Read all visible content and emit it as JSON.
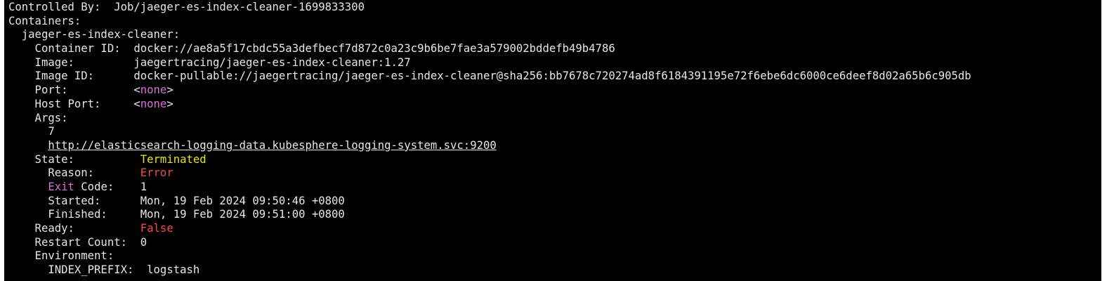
{
  "terminal": {
    "lines": [
      {
        "id": "controlled-by",
        "segs": [
          {
            "t": "Controlled By:  Job/jaeger-es-index-cleaner-1699833300"
          }
        ]
      },
      {
        "id": "containers-header",
        "segs": [
          {
            "t": "Containers:"
          }
        ]
      },
      {
        "id": "container-name",
        "segs": [
          {
            "t": "  jaeger-es-index-cleaner:"
          }
        ]
      },
      {
        "id": "container-id",
        "segs": [
          {
            "t": "    Container ID:  docker://ae8a5f17cbdc55a3defbecf7d872c0a23c9b6be7fae3a579002bddefb49b4786"
          }
        ]
      },
      {
        "id": "image",
        "segs": [
          {
            "t": "    Image:         jaegertracing/jaeger-es-index-cleaner:1.27"
          }
        ]
      },
      {
        "id": "image-id",
        "segs": [
          {
            "t": "    Image ID:      docker-pullable://jaegertracing/jaeger-es-index-cleaner@sha256:bb7678c720274ad8f6184391195e72f6ebe6dc6000ce6deef8d02a65b6c905db"
          }
        ]
      },
      {
        "id": "port",
        "segs": [
          {
            "t": "    Port:          <"
          },
          {
            "t": "none",
            "c": "magenta"
          },
          {
            "t": ">"
          }
        ]
      },
      {
        "id": "host-port",
        "segs": [
          {
            "t": "    Host Port:     <"
          },
          {
            "t": "none",
            "c": "magenta"
          },
          {
            "t": ">"
          }
        ]
      },
      {
        "id": "args-header",
        "segs": [
          {
            "t": "    Args:"
          }
        ]
      },
      {
        "id": "arg-days",
        "segs": [
          {
            "t": "      7"
          }
        ]
      },
      {
        "id": "arg-url",
        "segs": [
          {
            "t": "      "
          },
          {
            "t": "http://elasticsearch-logging-data.kubesphere-logging-system.svc:9200",
            "link": true
          }
        ]
      },
      {
        "id": "state",
        "segs": [
          {
            "t": "    State:          "
          },
          {
            "t": "Terminated",
            "c": "yellow"
          }
        ]
      },
      {
        "id": "reason",
        "segs": [
          {
            "t": "      Reason:       "
          },
          {
            "t": "Error",
            "c": "red"
          }
        ]
      },
      {
        "id": "exit-code",
        "segs": [
          {
            "t": "      "
          },
          {
            "t": "Exit",
            "c": "magenta"
          },
          {
            "t": " Code:    1"
          }
        ]
      },
      {
        "id": "started",
        "segs": [
          {
            "t": "      Started:      Mon, 19 Feb 2024 09:50:46 +0800"
          }
        ]
      },
      {
        "id": "finished",
        "segs": [
          {
            "t": "      Finished:     Mon, 19 Feb 2024 09:51:00 +0800"
          }
        ]
      },
      {
        "id": "ready",
        "segs": [
          {
            "t": "    Ready:          "
          },
          {
            "t": "False",
            "c": "red"
          }
        ]
      },
      {
        "id": "restart-count",
        "segs": [
          {
            "t": "    Restart Count:  0"
          }
        ]
      },
      {
        "id": "environment-header",
        "segs": [
          {
            "t": "    Environment:"
          }
        ]
      },
      {
        "id": "env-index-prefix",
        "segs": [
          {
            "t": "      INDEX_PREFIX:  logstash"
          }
        ]
      }
    ]
  }
}
